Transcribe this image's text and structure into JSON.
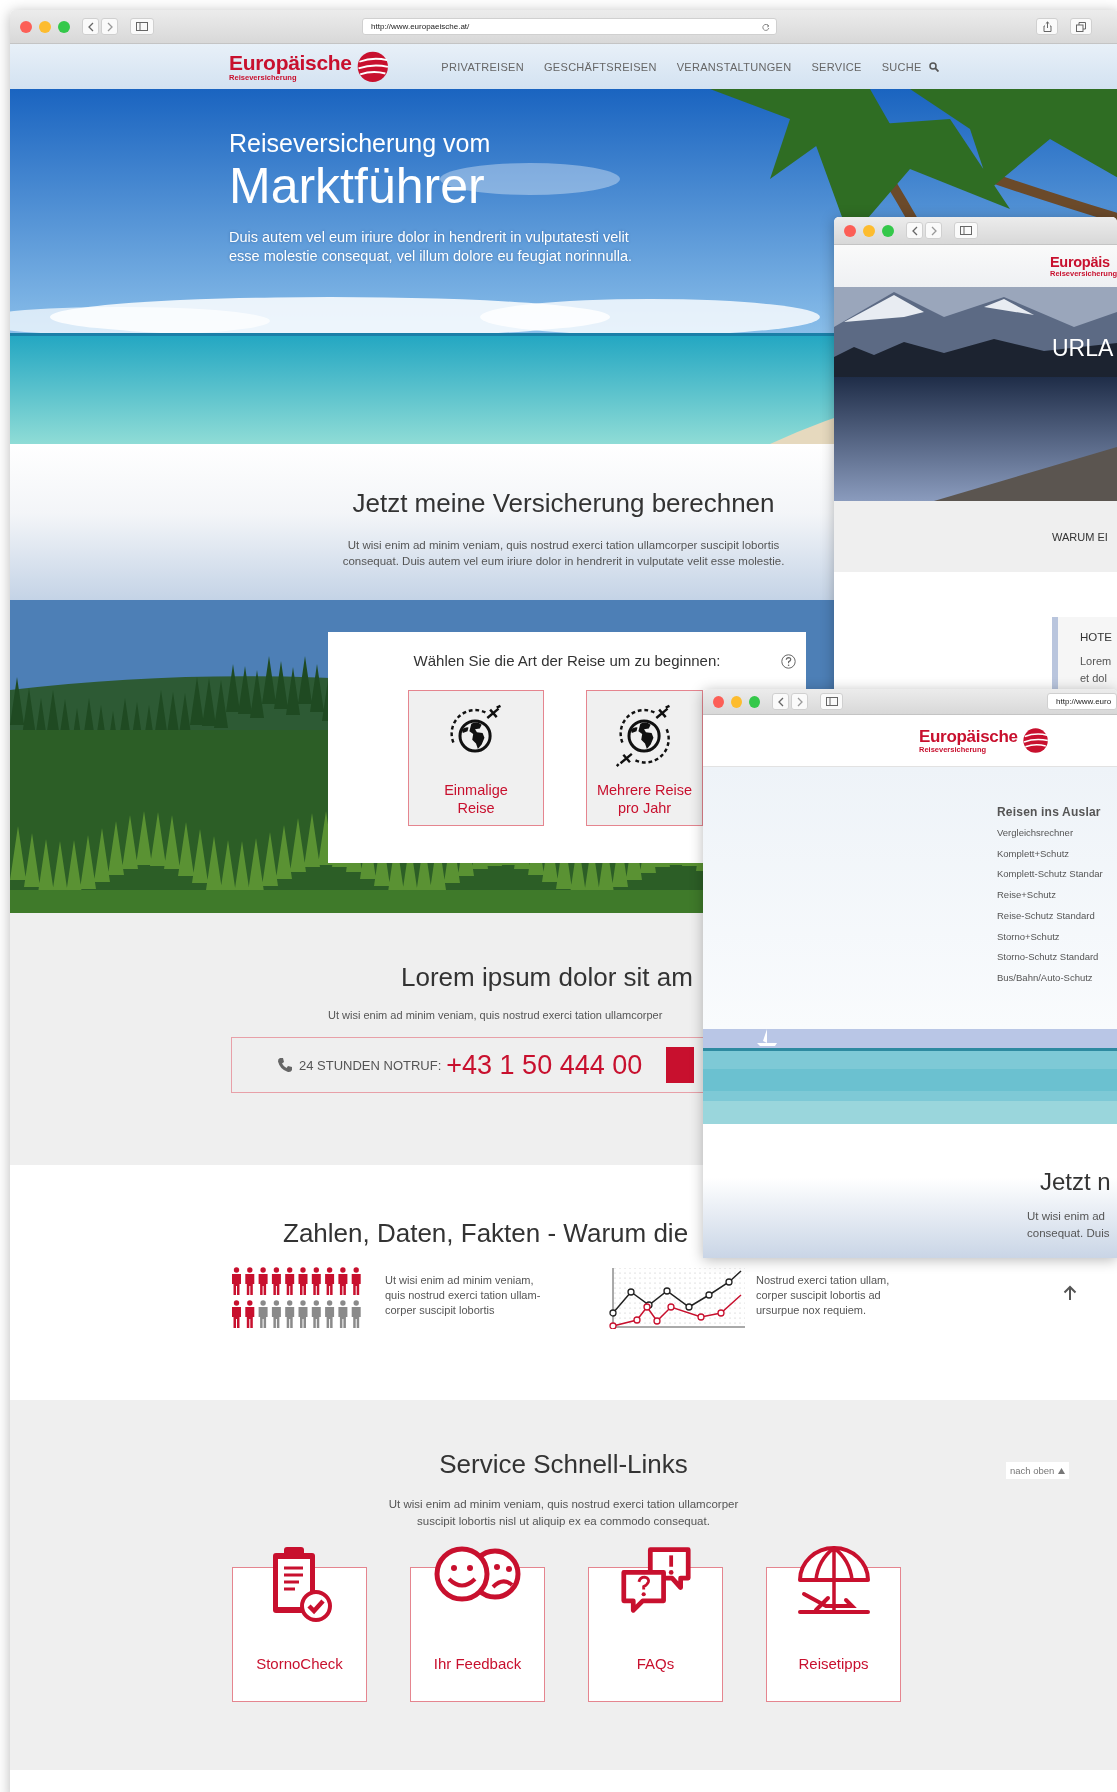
{
  "main_window": {
    "url": "http://www.europaeische.at/",
    "logo": {
      "name": "Europäische",
      "tagline": "Reiseversicherung"
    },
    "nav": [
      {
        "kind": "link",
        "label": "PRIVATREISEN"
      },
      {
        "kind": "link",
        "label": "GESCHÄFTSREISEN"
      },
      {
        "kind": "link",
        "label": "VERANSTALTUNGEN"
      },
      {
        "kind": "link",
        "label": "SERVICE"
      },
      {
        "kind": "search",
        "label": "SUCHE"
      }
    ],
    "hero": {
      "kicker": "Reiseversicherung vom",
      "title": "Marktführer",
      "text": "Duis autem vel eum iriure dolor in hendrerit in vulputatesti velit\nesse molestie consequat, vel illum dolore eu feugiat norinnulla."
    },
    "calculator": {
      "title": "Jetzt meine Versicherung berechnen",
      "text": "Ut wisi enim ad minim veniam, quis nostrud exerci tation ullamcorper suscipit lobortis\nconsequat. Duis autem vel eum iriure dolor in hendrerit in vulputate velit esse molestie.",
      "question": "Wählen Sie die Art der Reise um zu beginnen:",
      "options": [
        {
          "kind": "single",
          "label": "Einmalige\nReise"
        },
        {
          "kind": "multiple",
          "label": "Mehrere Reise\npro Jahr"
        }
      ]
    },
    "emergency": {
      "title": "Lorem ipsum dolor sit am",
      "text": "Ut wisi enim ad minim veniam, quis nostrud exerci tation ullamcorper",
      "label": "24 STUNDEN NOTRUF:",
      "number": "+43 1 50 444 00"
    },
    "facts": {
      "title": "Zahlen, Daten, Fakten - Warum die",
      "items": [
        {
          "kind": "people",
          "text": "Ut wisi enim ad minim veniam,\nquis nostrud exerci tation ullam-\ncorper suscipit lobortis"
        },
        {
          "kind": "chart",
          "text": "Nostrud exerci tation ullam,\ncorper suscipit lobortis ad\nursurpue nox requiem."
        }
      ]
    },
    "service": {
      "title": "Service Schnell-Links",
      "text": "Ut wisi enim ad minim veniam, quis nostrud exerci tation ullamcorper\nsuscipit lobortis nisl ut aliquip ex ea commodo consequat.",
      "back_to_top": "nach oben",
      "links": [
        {
          "kind": "storno",
          "label": "StornoCheck"
        },
        {
          "kind": "feedback",
          "label": "Ihr Feedback"
        },
        {
          "kind": "faq",
          "label": "FAQs"
        },
        {
          "kind": "tips",
          "label": "Reisetipps"
        }
      ]
    }
  },
  "window_2": {
    "logo": {
      "name": "Europäis",
      "tagline": "Reiseversicherung"
    },
    "hero_title": "URLA",
    "band_text": "WARUM EI",
    "card": {
      "title": "HOTE",
      "lines": [
        "Lorem",
        "et dol"
      ]
    }
  },
  "window_3": {
    "url": "http://www.euro",
    "logo": {
      "name": "Europäische",
      "tagline": "Reiseversicherung"
    },
    "menu": {
      "title": "Reisen ins Auslar",
      "items": [
        "Vergleichsrechner",
        "Komplett+Schutz",
        "Komplett-Schutz Standar",
        "Reise+Schutz",
        "Reise-Schutz Standard",
        "Storno+Schutz",
        "Storno-Schutz Standard",
        "Bus/Bahn/Auto-Schutz"
      ]
    },
    "title": "Jetzt n",
    "text": "Ut wisi enim ad\nconsequat. Duis"
  }
}
